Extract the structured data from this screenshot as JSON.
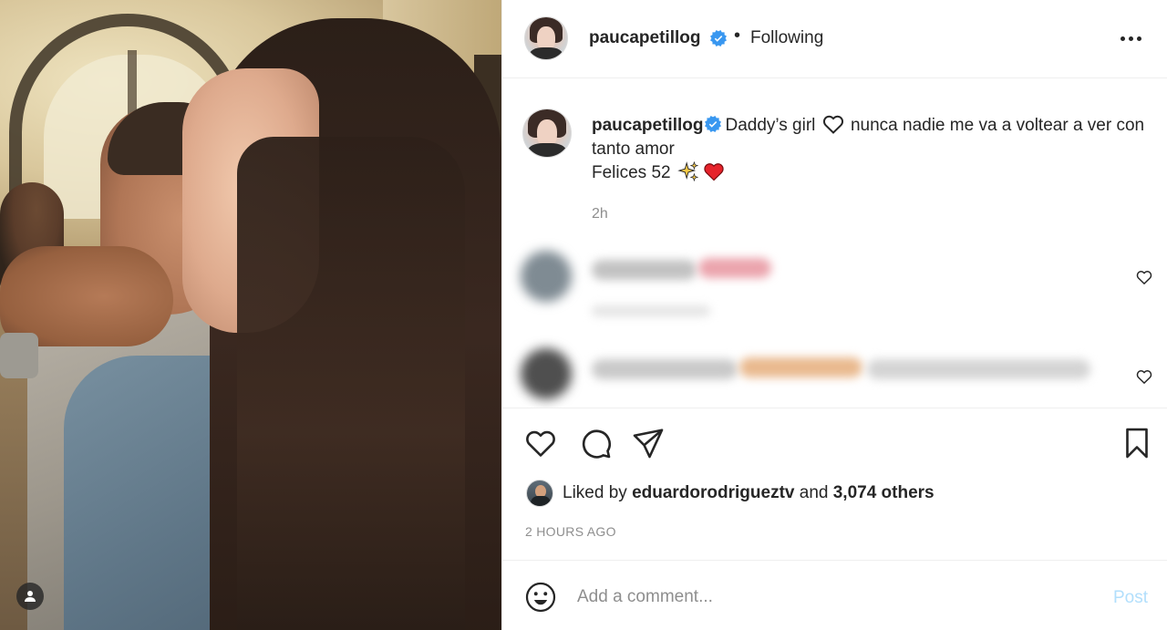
{
  "post": {
    "username": "paucapetillog",
    "follow_status": "Following",
    "separator": "•"
  },
  "caption": {
    "username": "paucapetillog",
    "line1_before_heart": "Daddy’s girl",
    "line1_after_heart": "nunca nadie me va a voltear a ver con tanto amor",
    "line2": "Felices 52",
    "line2_emojis": [
      "sparkles",
      "red-heart"
    ],
    "time": "2h"
  },
  "blurred_comments": [
    {
      "name_color": "#b8b8b8",
      "tag_color": "#e8a0a8"
    },
    {
      "name_color": "#bdbdbd",
      "tag_color": "#e6b38a"
    }
  ],
  "likes": {
    "prefix": "Liked by",
    "user": "eduardorodrigueztv",
    "middle": "and",
    "others": "3,074 others"
  },
  "timestamp": "2 HOURS AGO",
  "comment_box": {
    "placeholder": "Add a comment...",
    "post_label": "Post"
  },
  "colors": {
    "verified": "#3897f0",
    "post_button": "#b2dffc",
    "muted": "#8e8e8e",
    "heart_red": "#ed4956"
  },
  "icons": [
    "user-tag-icon",
    "verified-icon",
    "more-icon",
    "heart-icon",
    "comment-icon",
    "share-icon",
    "bookmark-icon",
    "emoji-icon"
  ]
}
